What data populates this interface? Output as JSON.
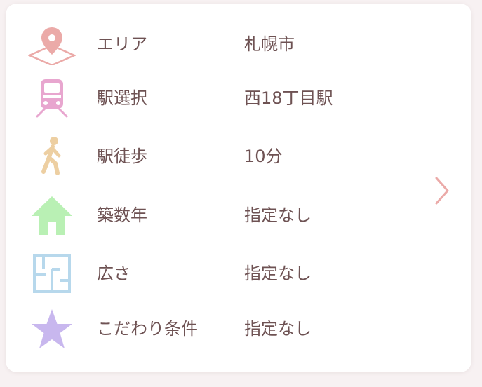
{
  "conditions": [
    {
      "icon": "map-pin-icon",
      "label": "エリア",
      "value": "札幌市"
    },
    {
      "icon": "train-icon",
      "label": "駅選択",
      "value": "西18丁目駅"
    },
    {
      "icon": "walking-person-icon",
      "label": "駅徒歩",
      "value": "10分"
    },
    {
      "icon": "house-icon",
      "label": "築数年",
      "value": "指定なし"
    },
    {
      "icon": "floor-plan-icon",
      "label": "広さ",
      "value": "指定なし"
    },
    {
      "icon": "star-icon",
      "label": "こだわり条件",
      "value": "指定なし"
    }
  ],
  "colors": {
    "text": "#6e5253",
    "pin": "#ebaaa8",
    "train": "#e8a6cf",
    "walker": "#edcfa2",
    "house": "#b9f0b4",
    "floorplan": "#b7d8ec",
    "star": "#c8b7ee",
    "chevron": "#ebaaa8"
  },
  "chevron_icon": "chevron-right-icon"
}
